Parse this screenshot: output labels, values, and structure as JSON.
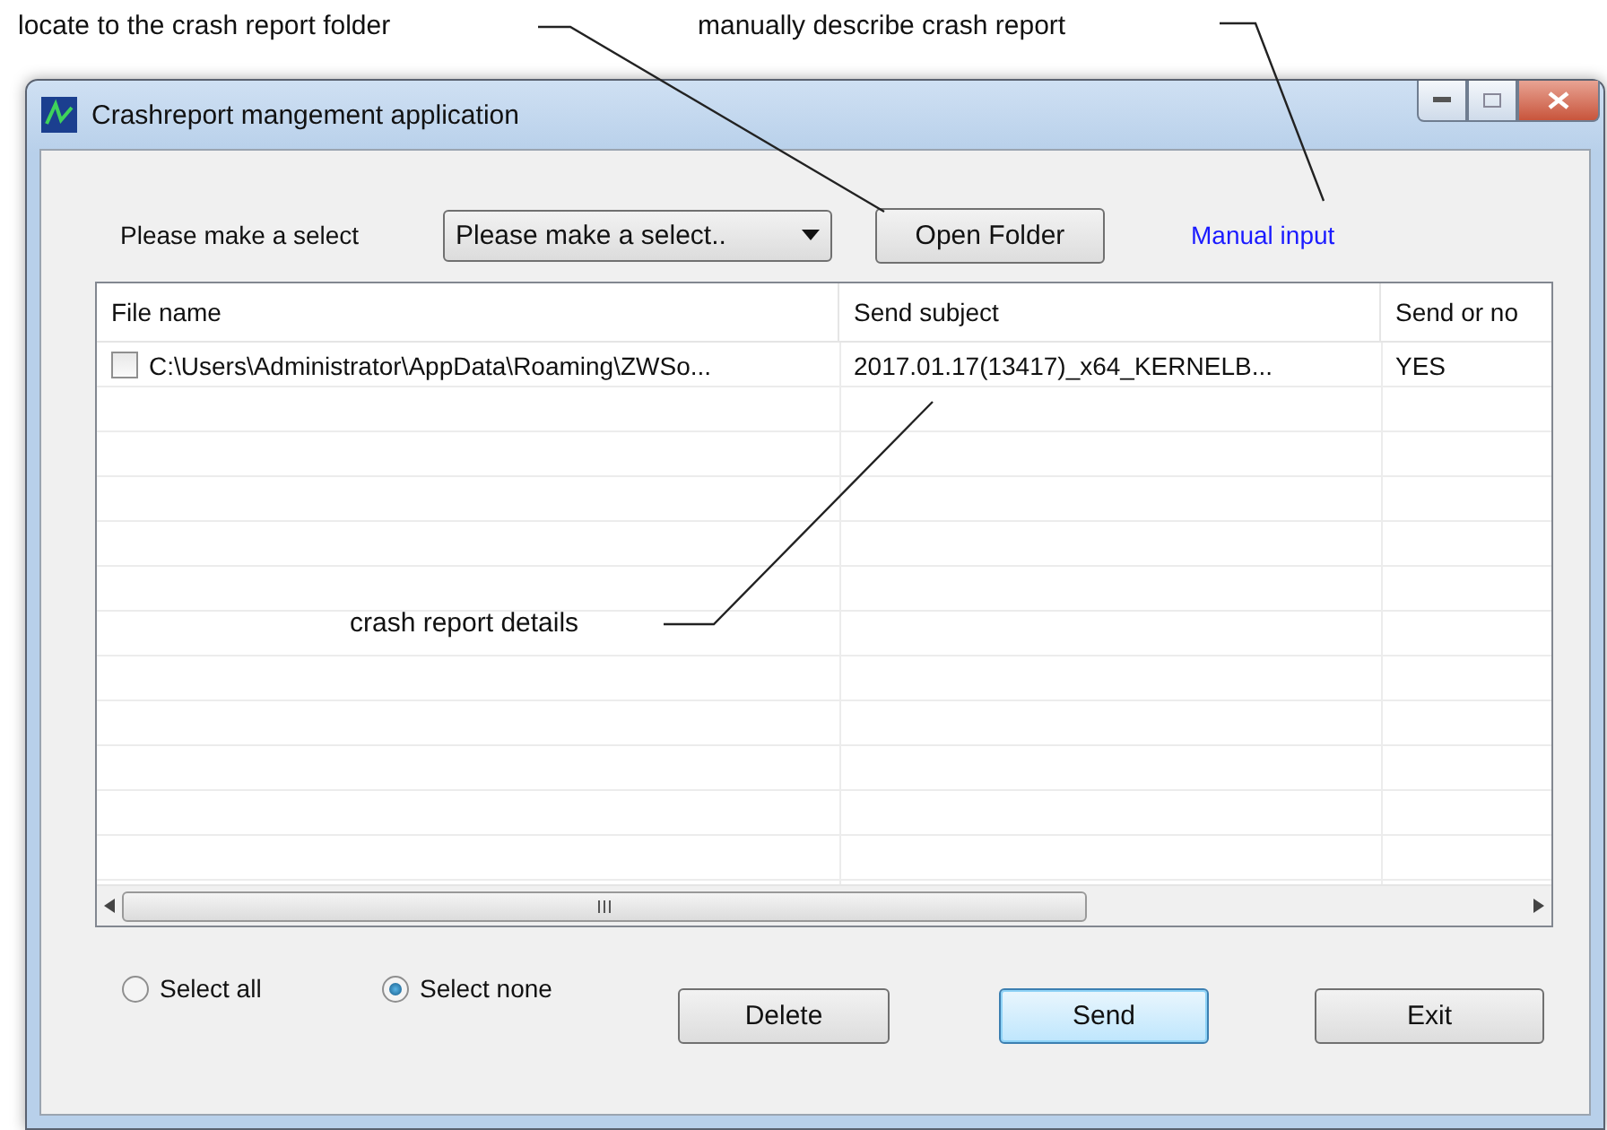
{
  "annotations": [
    {
      "text": "locate to the crash report folder"
    },
    {
      "text": "manually describe crash report"
    },
    {
      "text": "crash report details"
    }
  ],
  "window": {
    "title": "Crashreport mangement application"
  },
  "toolbar": {
    "label": "Please make a select",
    "select_value": "Please make a select..",
    "open_button": "Open Folder",
    "manual_link": "Manual input"
  },
  "table": {
    "columns": [
      "File name",
      "Send subject",
      "Send or no"
    ],
    "rows": [
      {
        "checked": false,
        "cells": [
          "C:\\Users\\Administrator\\AppData\\Roaming\\ZWSo...",
          "2017.01.17(13417)_x64_KERNELB...",
          "YES"
        ]
      }
    ]
  },
  "radios": [
    {
      "label": "Select all",
      "selected": false
    },
    {
      "label": "Select none",
      "selected": true
    }
  ],
  "buttons": [
    {
      "label": "Delete",
      "default": false
    },
    {
      "label": "Send",
      "default": true
    },
    {
      "label": "Exit",
      "default": false
    }
  ]
}
